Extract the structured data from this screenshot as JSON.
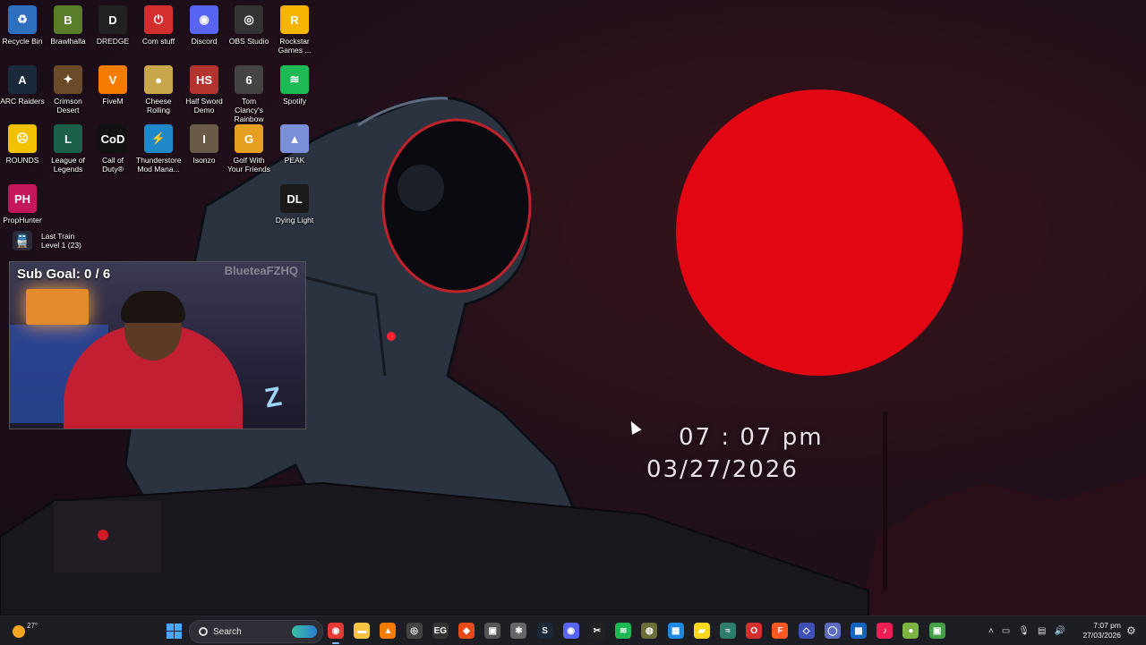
{
  "desktop": {
    "icons": [
      {
        "label": "Recycle Bin",
        "icon": "recycle-bin-icon",
        "color": "#2f6fbf",
        "glyph": "♻"
      },
      {
        "label": "Brawlhalla",
        "icon": "brawlhalla-icon",
        "color": "#5a7d2a",
        "glyph": "B"
      },
      {
        "label": "DREDGE",
        "icon": "dredge-icon",
        "color": "#222222",
        "glyph": "D"
      },
      {
        "label": "Com stuff",
        "icon": "com-stuff-icon",
        "color": "#d32f2f",
        "glyph": "⏻"
      },
      {
        "label": "Discord",
        "icon": "discord-icon",
        "color": "#5865F2",
        "glyph": "◉"
      },
      {
        "label": "OBS Studio",
        "icon": "obs-studio-icon",
        "color": "#333333",
        "glyph": "◎"
      },
      {
        "label": "Rockstar Games ...",
        "icon": "rockstar-games-icon",
        "color": "#f4b400",
        "glyph": "R"
      },
      {
        "label": "ARC Raiders",
        "icon": "arc-raiders-icon",
        "color": "#1a2a3a",
        "glyph": "A"
      },
      {
        "label": "Crimson Desert",
        "icon": "crimson-desert-icon",
        "color": "#6b4a2a",
        "glyph": "✦"
      },
      {
        "label": "FiveM",
        "icon": "fivem-icon",
        "color": "#f57c00",
        "glyph": "V"
      },
      {
        "label": "Cheese Rolling",
        "icon": "cheese-rolling-icon",
        "color": "#c8a64b",
        "glyph": "●"
      },
      {
        "label": "Half Sword Demo",
        "icon": "half-sword-icon",
        "color": "#b3342f",
        "glyph": "HS"
      },
      {
        "label": "Tom Clancy's Rainbow Si...",
        "icon": "rainbow-six-icon",
        "color": "#444444",
        "glyph": "6"
      },
      {
        "label": "Spotify",
        "icon": "spotify-icon",
        "color": "#1DB954",
        "glyph": "≋"
      },
      {
        "label": "ROUNDS",
        "icon": "rounds-icon",
        "color": "#f2c200",
        "glyph": "☹"
      },
      {
        "label": "League of Legends",
        "icon": "league-of-legends-icon",
        "color": "#1b5e4a",
        "glyph": "L"
      },
      {
        "label": "Call of Duty®",
        "icon": "call-of-duty-icon",
        "color": "#111111",
        "glyph": "CoD"
      },
      {
        "label": "Thunderstore Mod Mana...",
        "icon": "thunderstore-icon",
        "color": "#1e88c8",
        "glyph": "⚡"
      },
      {
        "label": "Isonzo",
        "icon": "isonzo-icon",
        "color": "#6a5a48",
        "glyph": "I"
      },
      {
        "label": "Golf With Your Friends",
        "icon": "golf-with-friends-icon",
        "color": "#e6a020",
        "glyph": "G"
      },
      {
        "label": "PEAK",
        "icon": "peak-icon",
        "color": "#7a8fd8",
        "glyph": "▲"
      },
      {
        "label": "PropHunter",
        "icon": "prophunter-icon",
        "color": "#c2185b",
        "glyph": "PH"
      },
      {
        "label": "Dying Light",
        "icon": "dying-light-icon",
        "color": "#1a1a1a",
        "glyph": "DL"
      }
    ],
    "last_train": {
      "line1": "Last Train",
      "line2": "Level 1  (23)"
    },
    "clock_time": "07 : 07   pm",
    "clock_date": "03/27/2026"
  },
  "webcam": {
    "sub_goal": "Sub Goal: 0 / 6",
    "handle": "BlueteaFZHQ"
  },
  "taskbar": {
    "weather_temp": "27°",
    "search_placeholder": "Search",
    "apps": [
      {
        "name": "chrome-icon",
        "color": "#e53935",
        "glyph": "◉",
        "active": true
      },
      {
        "name": "file-explorer-icon",
        "color": "#f6c342",
        "glyph": "▬",
        "active": false
      },
      {
        "name": "vlc-icon",
        "color": "#f57c00",
        "glyph": "▲",
        "active": false
      },
      {
        "name": "obs-icon",
        "color": "#444444",
        "glyph": "◎",
        "active": false
      },
      {
        "name": "epic-games-icon",
        "color": "#333333",
        "glyph": "EG",
        "active": false
      },
      {
        "name": "brave-icon",
        "color": "#e64a19",
        "glyph": "◆",
        "active": false
      },
      {
        "name": "app-icon",
        "color": "#555555",
        "glyph": "▣",
        "active": false
      },
      {
        "name": "app-icon-2",
        "color": "#666666",
        "glyph": "✱",
        "active": false
      },
      {
        "name": "steam-icon",
        "color": "#1b2838",
        "glyph": "S",
        "active": false
      },
      {
        "name": "discord-icon",
        "color": "#5865F2",
        "glyph": "◉",
        "active": false
      },
      {
        "name": "capcut-icon",
        "color": "#222222",
        "glyph": "✂",
        "active": false
      },
      {
        "name": "spotify-icon",
        "color": "#1DB954",
        "glyph": "≋",
        "active": false
      },
      {
        "name": "app-icon-3",
        "color": "#6d6d3a",
        "glyph": "◍",
        "active": false
      },
      {
        "name": "photos-icon",
        "color": "#1e88e5",
        "glyph": "▦",
        "active": false
      },
      {
        "name": "sticky-notes-icon",
        "color": "#f9d71c",
        "glyph": "▰",
        "active": false
      },
      {
        "name": "app-icon-4",
        "color": "#2e7d6b",
        "glyph": "≈",
        "active": false
      },
      {
        "name": "opera-icon",
        "color": "#d32f2f",
        "glyph": "O",
        "active": false
      },
      {
        "name": "faceit-icon",
        "color": "#ff5722",
        "glyph": "F",
        "active": false
      },
      {
        "name": "app-icon-5",
        "color": "#3f51b5",
        "glyph": "◇",
        "active": false
      },
      {
        "name": "app-icon-6",
        "color": "#5c6bc0",
        "glyph": "◯",
        "active": false
      },
      {
        "name": "app-icon-7",
        "color": "#1565c0",
        "glyph": "▩",
        "active": false
      },
      {
        "name": "tiktok-icon",
        "color": "#ee1d52",
        "glyph": "♪",
        "active": false
      },
      {
        "name": "app-icon-8",
        "color": "#7cb342",
        "glyph": "●",
        "active": false
      },
      {
        "name": "app-icon-9",
        "color": "#43a047",
        "glyph": "▣",
        "active": false
      }
    ],
    "time": "7:07 pm",
    "date": "27/03/2026"
  }
}
